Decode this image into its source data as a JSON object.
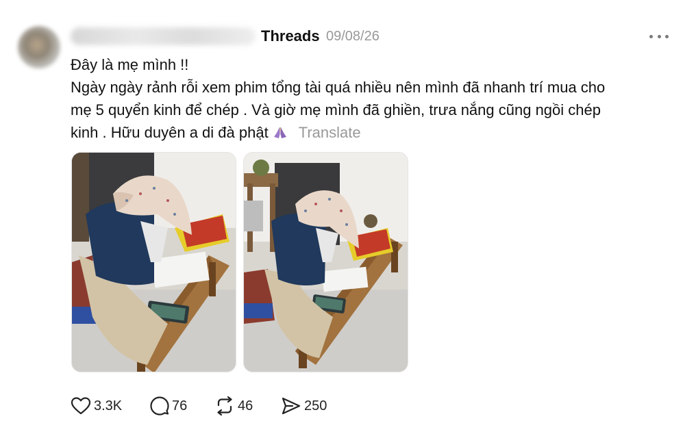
{
  "post": {
    "app_name": "Threads",
    "date": "09/08/26",
    "text_lines": [
      "Đây là mẹ mình !!",
      "Ngày ngày rảnh rỗi xem phim tổng tài quá nhiều nên mình đã nhanh trí mua cho",
      "mẹ 5 quyển kinh để chép . Và giờ mẹ mình đã ghiền, trưa nắng cũng ngồi chép",
      "kinh . Hữu duyên a di đà phật"
    ],
    "translate_label": "Translate",
    "images": [
      "photo-woman-copying-scripture-1",
      "photo-woman-copying-scripture-2"
    ]
  },
  "actions": {
    "likes": "3.3K",
    "comments": "76",
    "reposts": "46",
    "shares": "250"
  },
  "icons": {
    "like": "heart-icon",
    "comment": "comment-bubble-icon",
    "repost": "repost-icon",
    "share": "send-icon",
    "more": "more-options-icon",
    "emoji": "praying-hands-emoji"
  },
  "colors": {
    "text": "#111111",
    "muted": "#999999",
    "icon": "#222222"
  }
}
